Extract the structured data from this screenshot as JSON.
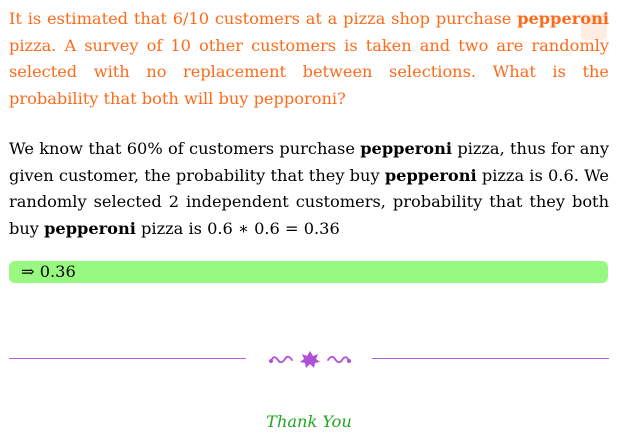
{
  "question": {
    "part1": "It is estimated that 6/10 customers at a pizza shop purchase ",
    "bold1": "pepperoni",
    "part2": " pizza.  A survey of 10 other customers is taken and two are randomly selected with no replacement between selections. What is the probability that both will buy pepporoni?"
  },
  "explanation": {
    "t1": "We know that 60% of customers purchase ",
    "b1": "pepperoni",
    "t2": " pizza, thus for any given customer, the probability that they buy ",
    "b2": "pepperoni",
    "t3": " pizza is 0.6. We randomly selected 2 independent customers, probability that they both buy ",
    "b3": "pepperoni",
    "t4": " pizza is 0.6 ∗ 0.6 = 0.36"
  },
  "answer": {
    "arrow": "⇒",
    "value": "0.36"
  },
  "closing": "Thank You",
  "colors": {
    "question_text": "#ff6a1a",
    "answer_box": "#98f980",
    "divider": "#b560e0",
    "closing_text": "#1fa81f"
  }
}
